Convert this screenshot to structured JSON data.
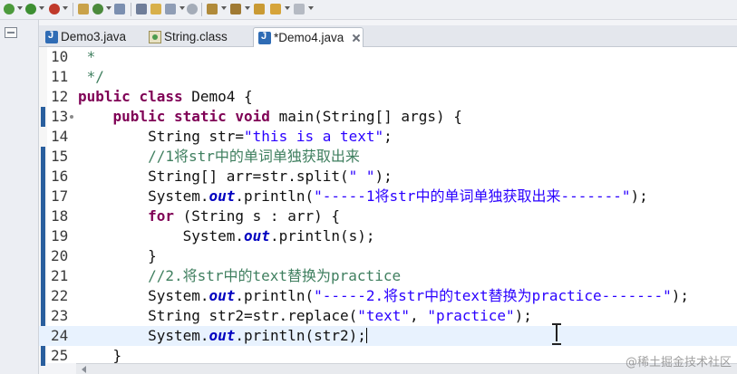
{
  "toolbar": {
    "icons": [
      "debug-icon",
      "run-icon",
      "new-package-icon",
      "run-last-icon",
      "open-type-icon",
      "open-task-icon",
      "search-icon",
      "annotation-icon",
      "navigate-back-icon",
      "navigate-forward-icon"
    ]
  },
  "tabs": [
    {
      "label": "Demo3.java",
      "icon": "java-file-icon",
      "active": false
    },
    {
      "label": "String.class",
      "icon": "class-file-icon",
      "active": false
    },
    {
      "label": "*Demo4.java",
      "icon": "java-file-icon",
      "active": true
    }
  ],
  "editor": {
    "current_line": 24,
    "lines": [
      {
        "num": "10",
        "text": " *"
      },
      {
        "num": "11",
        "text": " */"
      },
      {
        "num": "12",
        "text": "public class Demo4 {"
      },
      {
        "num": "13",
        "text": "    public static void main(String[] args) {"
      },
      {
        "num": "14",
        "text": "        String str=\"this is a text\";"
      },
      {
        "num": "15",
        "text": "        //1将str中的单词单独获取出来"
      },
      {
        "num": "16",
        "text": "        String[] arr=str.split(\" \");"
      },
      {
        "num": "17",
        "text": "        System.out.println(\"-----1将str中的单词单独获取出来-------\");"
      },
      {
        "num": "18",
        "text": "        for (String s : arr) {"
      },
      {
        "num": "19",
        "text": "            System.out.println(s);"
      },
      {
        "num": "20",
        "text": "        }"
      },
      {
        "num": "21",
        "text": "        //2.将str中的text替换为practice"
      },
      {
        "num": "22",
        "text": "        System.out.println(\"-----2.将str中的text替换为practice-------\");"
      },
      {
        "num": "23",
        "text": "        String str2=str.replace(\"text\", \"practice\");"
      },
      {
        "num": "24",
        "text": "        System.out.println(str2);"
      },
      {
        "num": "25",
        "text": "    }"
      }
    ]
  },
  "watermark": "@稀土掘金技术社区",
  "colors": {
    "keyword": "#7f0055",
    "string": "#2a00ff",
    "comment": "#3f7f5f",
    "field": "#0000c0",
    "current_line": "#e8f2fe"
  }
}
